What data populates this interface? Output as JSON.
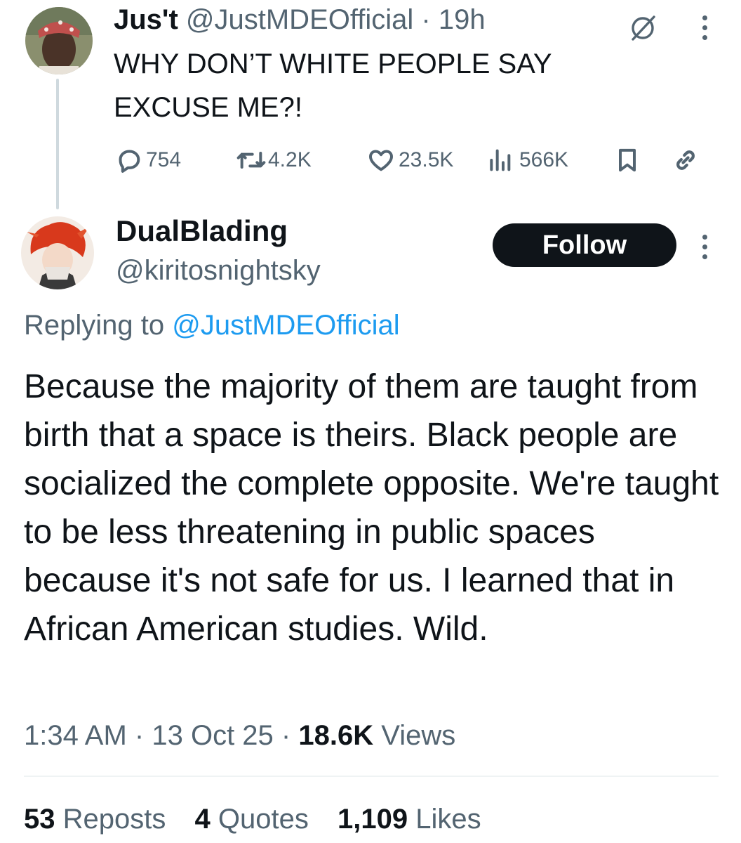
{
  "parent_tweet": {
    "author_name": "Jus't",
    "author_handle": "@JustMDEOfficial",
    "separator": "·",
    "time": "19h",
    "text_line1": "WHY DON’T WHITE PEOPLE SAY",
    "text_line2": "EXCUSE ME?!",
    "replies": "754",
    "reposts": "4.2K",
    "likes": "23.5K",
    "views": "566K",
    "icons": [
      "grok-icon",
      "more-options-icon",
      "reply-icon",
      "repost-icon",
      "like-icon",
      "views-icon",
      "bookmark-icon",
      "share-icon"
    ]
  },
  "reply_tweet": {
    "author_name": "DualBlading",
    "author_handle": "@kiritosnightsky",
    "follow_label": "Follow",
    "replying_prefix": "Replying to",
    "replying_mention": "@JustMDEOfficial",
    "body": "Because the majority of them are taught from birth that a space is theirs. Black people are socialized the complete opposite. We're taught to be less threatening in public spaces because it's not safe for us. I learned that in African American studies. Wild.",
    "time": "1:34 AM",
    "date": "13 Oct 25",
    "view_count": "18.6K",
    "views_label": "Views"
  },
  "engagement": {
    "reposts_count": "53",
    "reposts_label": "Reposts",
    "quotes_count": "4",
    "quotes_label": "Quotes",
    "likes_count": "1,109",
    "likes_label": "Likes"
  },
  "colors": {
    "text": "#0f1419",
    "secondary": "#536471",
    "link": "#1d9bf0",
    "follow_bg": "#0f1419"
  }
}
